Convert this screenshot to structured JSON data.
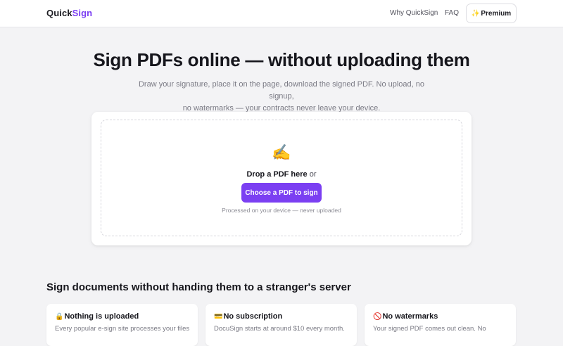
{
  "header": {
    "logo_part1": "Quick",
    "logo_part2": "Sign",
    "nav": [
      {
        "label": "Why QuickSign"
      },
      {
        "label": "FAQ"
      }
    ],
    "premium_icon": "✨",
    "premium_label": "Premium"
  },
  "hero": {
    "title": "Sign PDFs online — without uploading them",
    "subtitle_line1": "Draw your signature, place it on the page, download the signed PDF. No upload, no signup,",
    "subtitle_line2": "no watermarks — your contracts never leave your device."
  },
  "upload": {
    "icon": "✍️",
    "icon_name": "writing-hand-icon",
    "drop_label": "Drop a PDF here",
    "or_label": " or",
    "button_label": "Choose a PDF to sign",
    "note": "Processed on your device — never uploaded"
  },
  "features_section": {
    "title": "Sign documents without handing them to a stranger's server",
    "items": [
      {
        "icon": "🔒",
        "icon_name": "lock-icon",
        "title": "Nothing is uploaded",
        "text": "Every popular e-sign site processes your files"
      },
      {
        "icon": "💳",
        "icon_name": "credit-card-icon",
        "title": "No subscription",
        "text": "DocuSign starts at around $10 every month."
      },
      {
        "icon": "🚫",
        "icon_name": "no-entry-icon",
        "title": "No watermarks",
        "text": "Your signed PDF comes out clean. No"
      }
    ]
  },
  "colors": {
    "accent": "#7b3ff2",
    "background": "#f3f3f5",
    "card": "#ffffff"
  }
}
